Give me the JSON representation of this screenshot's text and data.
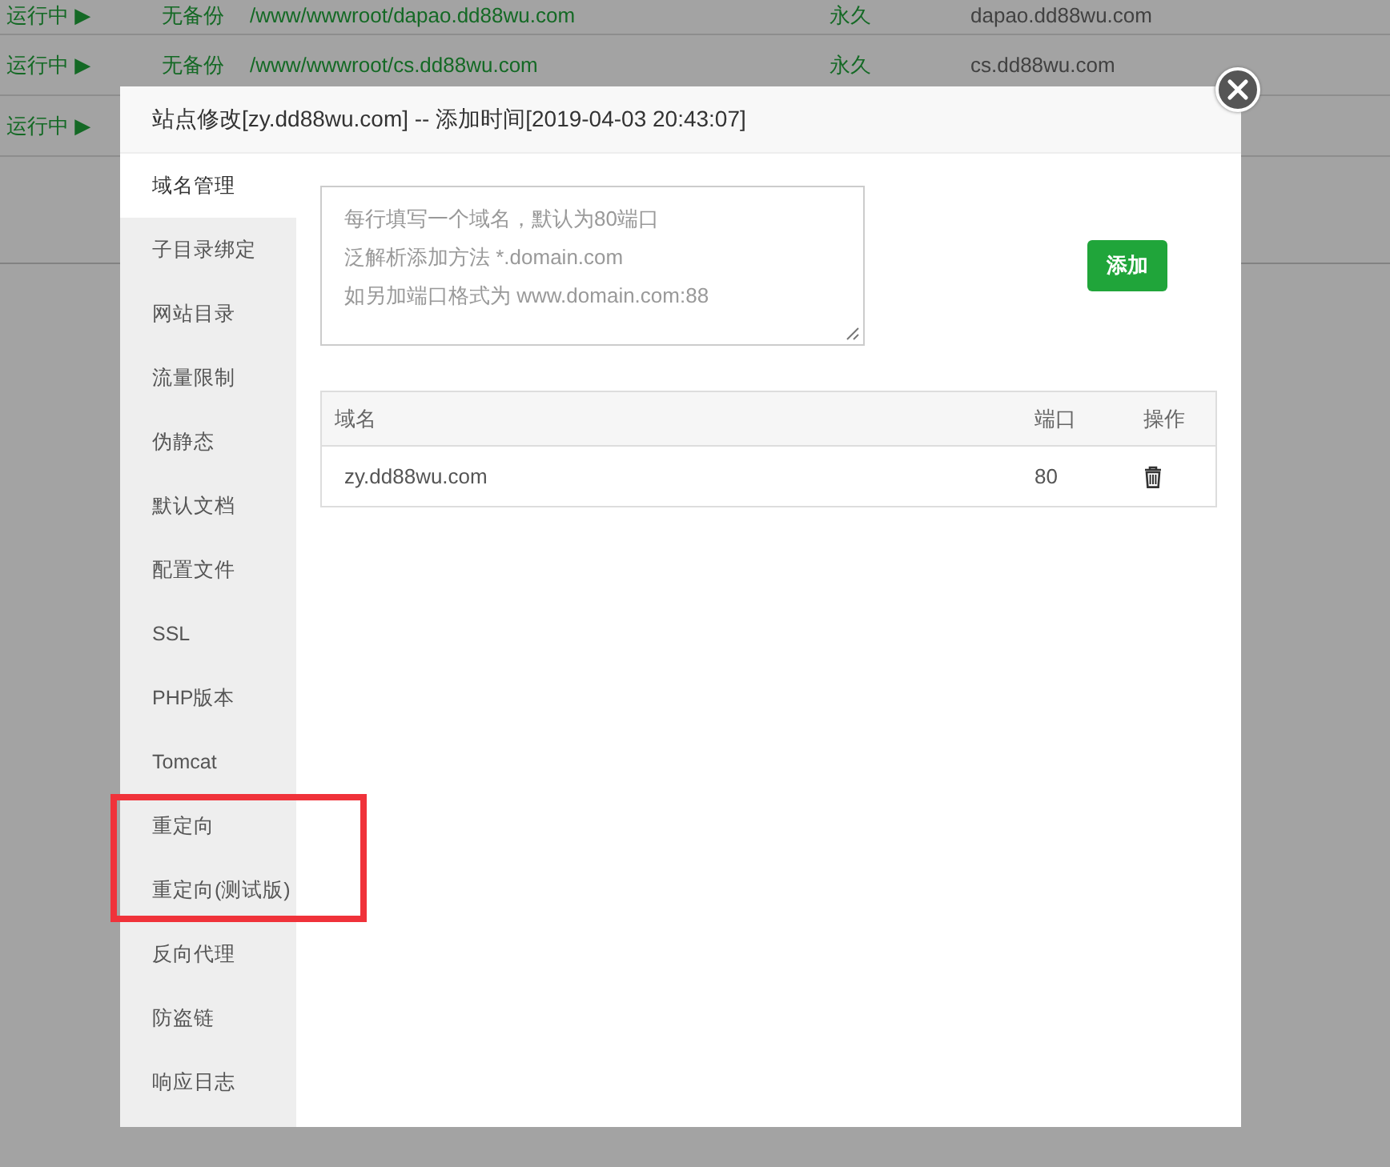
{
  "background": {
    "rows": [
      {
        "status": "运行中 ▶",
        "backup": "无备份",
        "path": "/www/wwwroot/dapao.dd88wu.com",
        "expiry": "永久",
        "domain": "dapao.dd88wu.com"
      },
      {
        "status": "运行中 ▶",
        "backup": "无备份",
        "path": "/www/wwwroot/cs.dd88wu.com",
        "expiry": "永久",
        "domain": "cs.dd88wu.com"
      },
      {
        "status": "运行中 ▶"
      }
    ]
  },
  "dialog": {
    "title": "站点修改[zy.dd88wu.com] -- 添加时间[2019-04-03 20:43:07]",
    "menu": [
      {
        "label": "域名管理",
        "selected": true,
        "highlighted": false
      },
      {
        "label": "子目录绑定",
        "selected": false,
        "highlighted": false
      },
      {
        "label": "网站目录",
        "selected": false,
        "highlighted": false
      },
      {
        "label": "流量限制",
        "selected": false,
        "highlighted": false
      },
      {
        "label": "伪静态",
        "selected": false,
        "highlighted": false
      },
      {
        "label": "默认文档",
        "selected": false,
        "highlighted": false
      },
      {
        "label": "配置文件",
        "selected": false,
        "highlighted": false
      },
      {
        "label": "SSL",
        "selected": false,
        "highlighted": false
      },
      {
        "label": "PHP版本",
        "selected": false,
        "highlighted": false
      },
      {
        "label": "Tomcat",
        "selected": false,
        "highlighted": false
      },
      {
        "label": "重定向",
        "selected": false,
        "highlighted": true
      },
      {
        "label": "重定向(测试版)",
        "selected": false,
        "highlighted": true
      },
      {
        "label": "反向代理",
        "selected": false,
        "highlighted": false
      },
      {
        "label": "防盗链",
        "selected": false,
        "highlighted": false
      },
      {
        "label": "响应日志",
        "selected": false,
        "highlighted": false
      }
    ],
    "domain_input": {
      "placeholder_lines": [
        "每行填写一个域名，默认为80端口",
        "泛解析添加方法 *.domain.com",
        "如另加端口格式为 www.domain.com:88"
      ]
    },
    "add_button": "添加",
    "table": {
      "columns": [
        "域名",
        "端口",
        "操作"
      ],
      "rows": [
        {
          "domain": "zy.dd88wu.com",
          "port": "80"
        }
      ]
    }
  }
}
